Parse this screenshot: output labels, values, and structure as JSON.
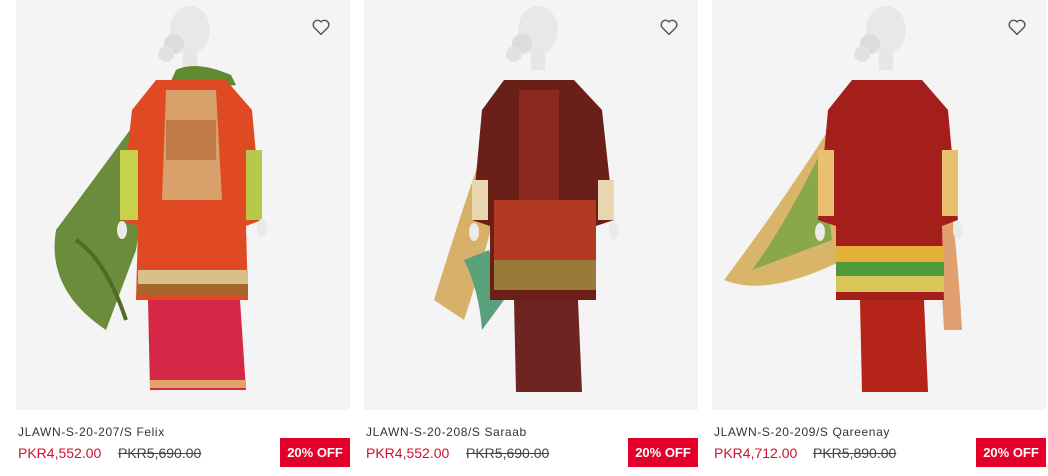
{
  "products": [
    {
      "name": "JLAWN-S-20-207/S Felix",
      "price": "PKR4,552.00",
      "original_price": "PKR5,690.00",
      "discount": "20% OFF",
      "wishlist_icon": "heart-outline-icon"
    },
    {
      "name": "JLAWN-S-20-208/S Saraab",
      "price": "PKR4,552.00",
      "original_price": "PKR5,690.00",
      "discount": "20% OFF",
      "wishlist_icon": "heart-outline-icon"
    },
    {
      "name": "JLAWN-S-20-209/S Qareenay",
      "price": "PKR4,712.00",
      "original_price": "PKR5,890.00",
      "discount": "20% OFF",
      "wishlist_icon": "heart-outline-icon"
    }
  ],
  "colors": {
    "sale_price": "#d0102e",
    "badge_bg": "#e4002b",
    "badge_text": "#ffffff",
    "image_bg": "#f4f4f4"
  }
}
